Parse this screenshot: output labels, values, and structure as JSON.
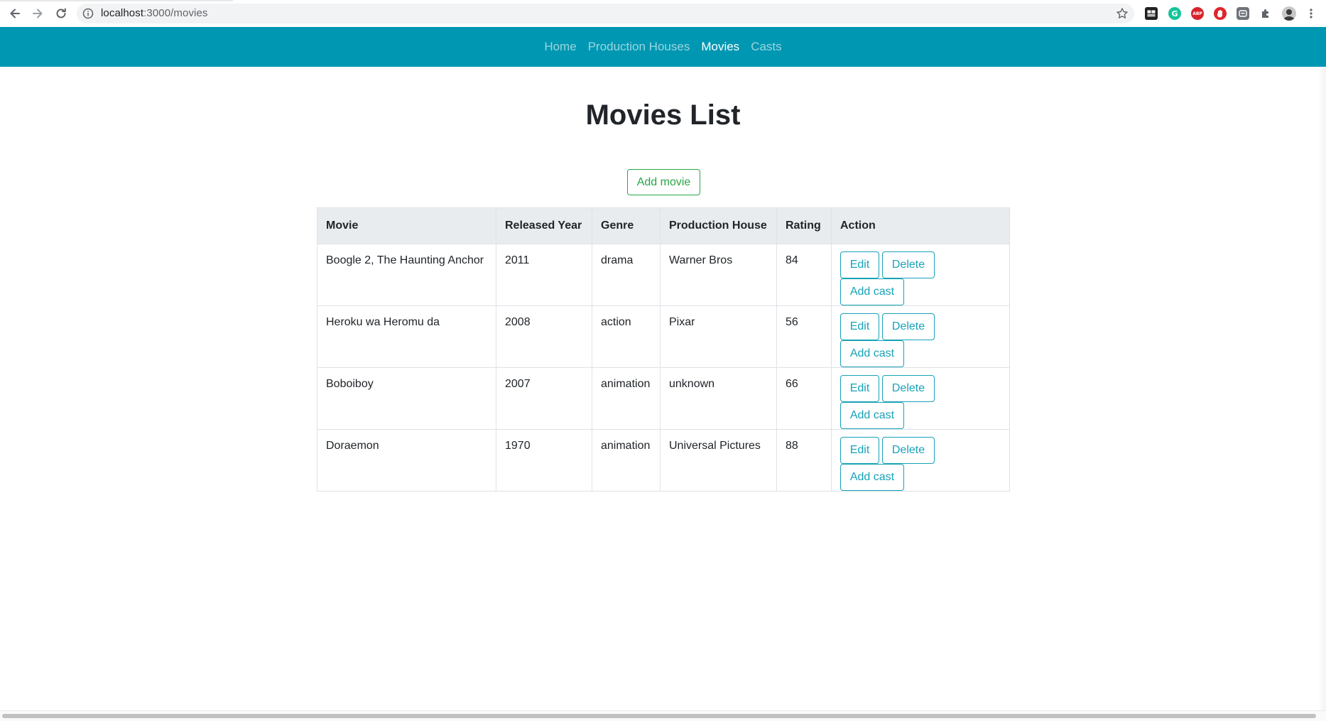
{
  "browser": {
    "url_host": "localhost",
    "url_path": ":3000/movies"
  },
  "nav": {
    "links": [
      {
        "label": "Home",
        "active": false
      },
      {
        "label": "Production Houses",
        "active": false
      },
      {
        "label": "Movies",
        "active": true
      },
      {
        "label": "Casts",
        "active": false
      }
    ]
  },
  "page": {
    "title": "Movies List",
    "add_button": "Add movie"
  },
  "table": {
    "headers": [
      "Movie",
      "Released Year",
      "Genre",
      "Production House",
      "Rating",
      "Action"
    ],
    "rows": [
      {
        "movie": "Boogle 2, The Haunting Anchor",
        "year": "2011",
        "genre": "drama",
        "house": "Warner Bros",
        "rating": "84"
      },
      {
        "movie": "Heroku wa Heromu da",
        "year": "2008",
        "genre": "action",
        "house": "Pixar",
        "rating": "56"
      },
      {
        "movie": "Boboiboy",
        "year": "2007",
        "genre": "animation",
        "house": "unknown",
        "rating": "66"
      },
      {
        "movie": "Doraemon",
        "year": "1970",
        "genre": "animation",
        "house": "Universal Pictures",
        "rating": "88"
      }
    ],
    "actions": {
      "edit": "Edit",
      "delete": "Delete",
      "add_cast": "Add cast"
    }
  },
  "extensions": [
    {
      "name": "tab-icon",
      "label": ""
    },
    {
      "name": "grammarly-icon",
      "label": "G"
    },
    {
      "name": "adblock-plus-icon",
      "label": "ABP"
    },
    {
      "name": "hand-stop-icon",
      "label": ""
    },
    {
      "name": "screen-capture-icon",
      "label": ""
    },
    {
      "name": "extensions-puzzle-icon",
      "label": ""
    },
    {
      "name": "profile-avatar-icon",
      "label": ""
    },
    {
      "name": "menu-kebab-icon",
      "label": ""
    }
  ],
  "colors": {
    "navbar": "#0097b2",
    "success": "#28a745",
    "info": "#17a2b8",
    "table_header": "#e9ecef"
  }
}
